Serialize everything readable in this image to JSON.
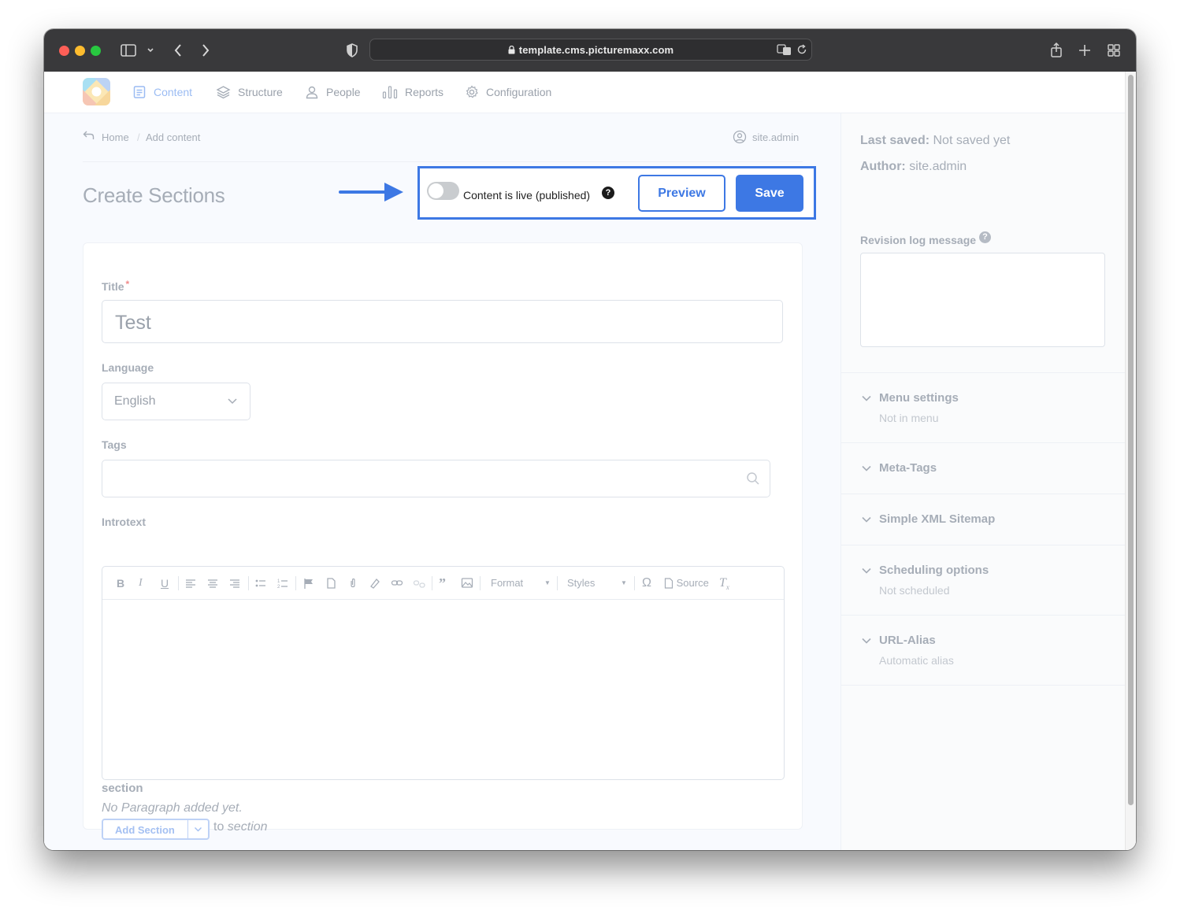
{
  "browser": {
    "url": "template.cms.picturemaxx.com"
  },
  "nav": {
    "items": [
      {
        "label": "Content",
        "icon": "document-icon"
      },
      {
        "label": "Structure",
        "icon": "layers-icon"
      },
      {
        "label": "People",
        "icon": "person-icon"
      },
      {
        "label": "Reports",
        "icon": "bar-chart-icon"
      },
      {
        "label": "Configuration",
        "icon": "gear-icon"
      }
    ]
  },
  "breadcrumb": {
    "home": "Home",
    "separator": "/",
    "current": "Add content",
    "user": "site.admin"
  },
  "page": {
    "title": "Create Sections"
  },
  "publish": {
    "toggle_label": "Content is live (published)",
    "toggle_on": false,
    "help": "?",
    "preview_label": "Preview",
    "save_label": "Save"
  },
  "form": {
    "title_label": "Title",
    "required_mark": "*",
    "title_value": "Test",
    "language_label": "Language",
    "language_value": "English",
    "tags_label": "Tags",
    "introtext_label": "Introtext",
    "toolbar": {
      "format": "Format",
      "styles": "Styles",
      "source": "Source"
    },
    "section_label": "section",
    "no_paragraph": "No Paragraph added yet.",
    "add_section": "Add Section",
    "to": "to",
    "to_target": "section"
  },
  "sidebar": {
    "last_saved_label": "Last saved:",
    "last_saved_value": "Not saved yet",
    "author_label": "Author:",
    "author_value": "site.admin",
    "revision_label": "Revision log message",
    "revision_help": "?",
    "accordions": [
      {
        "title": "Menu settings",
        "subtitle": "Not in menu"
      },
      {
        "title": "Meta-Tags",
        "subtitle": ""
      },
      {
        "title": "Simple XML Sitemap",
        "subtitle": ""
      },
      {
        "title": "Scheduling options",
        "subtitle": "Not scheduled"
      },
      {
        "title": "URL-Alias",
        "subtitle": "Automatic alias"
      }
    ]
  },
  "colors": {
    "accent": "#3d78e4",
    "muted_text": "#a6adb7",
    "titlebar": "#39393b"
  }
}
